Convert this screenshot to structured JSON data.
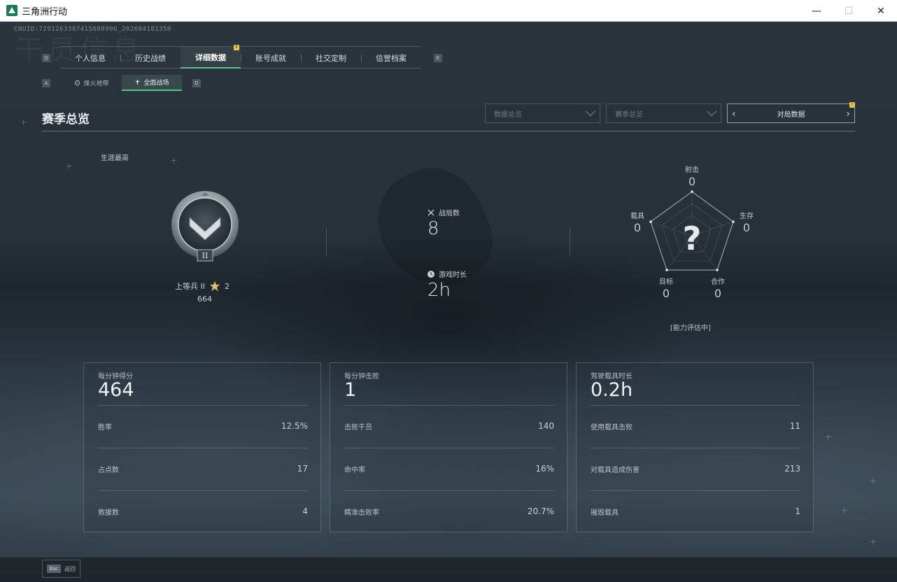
{
  "window": {
    "title": "三角洲行动",
    "minimize": "—",
    "maximize": "☐",
    "close": "✕"
  },
  "cnuid": "CNUID:7291263387415600996_202604181350",
  "watermark": "干员信息",
  "main_tabs": {
    "left_key": "Q",
    "right_key": "E",
    "items": [
      {
        "label": "个人信息",
        "active": false
      },
      {
        "label": "历史战绩",
        "active": false
      },
      {
        "label": "详细数据",
        "active": true,
        "badge": "!"
      },
      {
        "label": "账号成就",
        "active": false
      },
      {
        "label": "社交定制",
        "active": false
      },
      {
        "label": "信誉档案",
        "active": false
      }
    ]
  },
  "sub_tabs": {
    "left_key": "A",
    "right_key": "D",
    "items": [
      {
        "label": "烽火地带",
        "icon": "fire-zone-icon",
        "active": false
      },
      {
        "label": "全面战场",
        "icon": "battlefield-icon",
        "active": true
      }
    ]
  },
  "section": {
    "title": "赛季总览",
    "dropdown1": "数据总览",
    "dropdown2": "赛季总览",
    "pager_label": "对局数据",
    "pager_badge": "!"
  },
  "career": {
    "label": "生涯最高",
    "rank_name": "上等兵 II",
    "stars": "2",
    "score": "664",
    "rank_roman": "II"
  },
  "overview": {
    "matches_label": "战局数",
    "matches_value": "8",
    "playtime_label": "游戏时长",
    "playtime_value": "2h"
  },
  "radar": {
    "shooting": {
      "label": "射击",
      "value": "0"
    },
    "survival": {
      "label": "生存",
      "value": "0"
    },
    "cooperation": {
      "label": "合作",
      "value": "0"
    },
    "objective": {
      "label": "目标",
      "value": "0"
    },
    "vehicle": {
      "label": "载具",
      "value": "0"
    },
    "center": "?",
    "status": "[能力评估中]"
  },
  "cards": [
    {
      "title": "每分钟得分",
      "value": "464",
      "rows": [
        {
          "label": "胜率",
          "value": "12.5%"
        },
        {
          "label": "占点数",
          "value": "17"
        },
        {
          "label": "救援数",
          "value": "4"
        }
      ]
    },
    {
      "title": "每分钟击败",
      "value": "1",
      "rows": [
        {
          "label": "击败干员",
          "value": "140"
        },
        {
          "label": "命中率",
          "value": "16%"
        },
        {
          "label": "精准击败率",
          "value": "20.7%"
        }
      ]
    },
    {
      "title": "驾驶载具时长",
      "value": "0.2h",
      "rows": [
        {
          "label": "使用载具击败",
          "value": "11"
        },
        {
          "label": "对载具造成伤害",
          "value": "213"
        },
        {
          "label": "摧毁载具",
          "value": "1"
        }
      ]
    }
  ],
  "bottom": {
    "esc_key": "Esc",
    "back_label": "返回"
  }
}
